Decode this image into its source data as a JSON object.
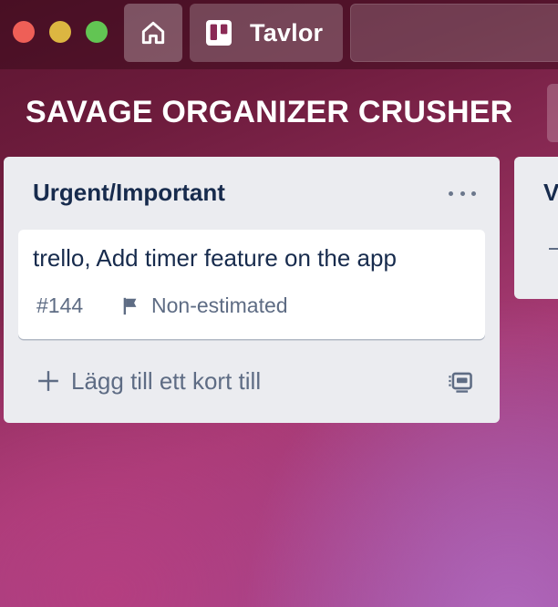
{
  "window": {
    "buttons": [
      "close",
      "minimize",
      "zoom"
    ]
  },
  "header": {
    "home_icon": "home-icon",
    "boards_icon": "trello-boards-icon",
    "boards_label": "Tavlor"
  },
  "board": {
    "title": "SAVAGE ORGANIZER CRUSHER"
  },
  "lists": [
    {
      "name": "Urgent/Important",
      "menu_icon": "more-horizontal-icon",
      "cards": [
        {
          "title": "trello, Add timer feature on the app",
          "number": "#144",
          "flag_icon": "flag-icon",
          "estimate": "Non-estimated"
        }
      ],
      "add_card_label": "Lägg till ett kort till",
      "template_icon": "card-template-icon"
    },
    {
      "name": "V"
    }
  ],
  "colors": {
    "list_bg": "#ebecf0",
    "text_dark": "#172b4d",
    "text_muted": "#5e6c84",
    "traffic_red": "#ee5f57",
    "traffic_yellow": "#dcb641",
    "traffic_green": "#62c553"
  }
}
